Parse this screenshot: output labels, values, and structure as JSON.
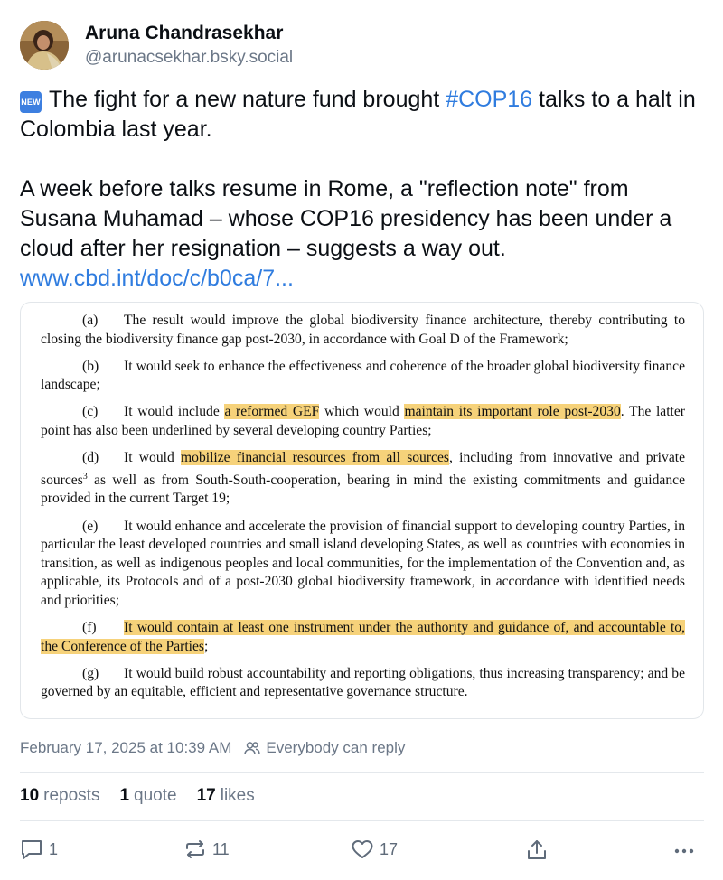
{
  "author": {
    "display_name": "Aruna Chandrasekhar",
    "handle": "@arunacsekhar.bsky.social"
  },
  "post": {
    "badge": "NEW",
    "line1_before": "The fight for a new nature fund brought ",
    "hashtag": "#COP16",
    "line1_after": " talks to a halt in Colombia last year.",
    "paragraph2": "A week before talks resume in Rome, a \"reflection note\" from Susana Muhamad  – whose COP16 presidency has been under a cloud after her resignation – suggests a way out.",
    "link": "www.cbd.int/doc/c/b0ca/7..."
  },
  "document": {
    "a": {
      "label": "(a)",
      "text": "The result would improve the global biodiversity finance architecture, thereby contributing to closing the biodiversity finance gap post-2030, in accordance with Goal D of the Framework;"
    },
    "b": {
      "label": "(b)",
      "text": "It would seek to enhance the effectiveness and coherence of the broader global biodiversity finance landscape;"
    },
    "c": {
      "label": "(c)",
      "t1": "It would include ",
      "h1": "a reformed GEF",
      "t2": " which would ",
      "h2": "maintain its important role post-2030",
      "t3": ". The latter point has also been underlined by several developing country Parties;"
    },
    "d": {
      "label": "(d)",
      "t1": "It would ",
      "h1": "mobilize financial resources from all sources",
      "t2": ", including from innovative and private sources",
      "sup": "3",
      "t3": " as well as from South-South-cooperation, bearing in mind the existing commitments and guidance provided in the current Target 19;"
    },
    "e": {
      "label": "(e)",
      "text": "It would enhance and accelerate the provision of financial support to developing country Parties, in particular the least developed countries and small island developing States, as well as countries with economies in transition, as well as indigenous peoples and local communities, for the implementation of the Convention and, as applicable, its Protocols and of a post-2030 global biodiversity framework, in accordance with identified needs and priorities;"
    },
    "f": {
      "label": "(f)",
      "h1": "It would contain at least one instrument under the authority and guidance of, and accountable to, the Conference of the Parties",
      "t1": ";"
    },
    "g": {
      "label": "(g)",
      "text": "It would build robust accountability and reporting obligations, thus increasing transparency; and be governed by an equitable, efficient and representative governance structure."
    }
  },
  "meta": {
    "timestamp": "February 17, 2025 at 10:39 AM",
    "reply_setting": "Everybody can reply"
  },
  "stats": {
    "reposts_count": "10",
    "reposts_label": "reposts",
    "quotes_count": "1",
    "quotes_label": "quote",
    "likes_count": "17",
    "likes_label": "likes"
  },
  "actions": {
    "reply_count": "1",
    "repost_count": "11",
    "like_count": "17"
  },
  "colors": {
    "link": "#2f7cdf",
    "highlight": "#f6d27a",
    "muted": "#6b7787"
  },
  "icons": [
    "reply-icon",
    "repost-icon",
    "like-icon",
    "share-icon",
    "more-icon",
    "people-icon"
  ]
}
